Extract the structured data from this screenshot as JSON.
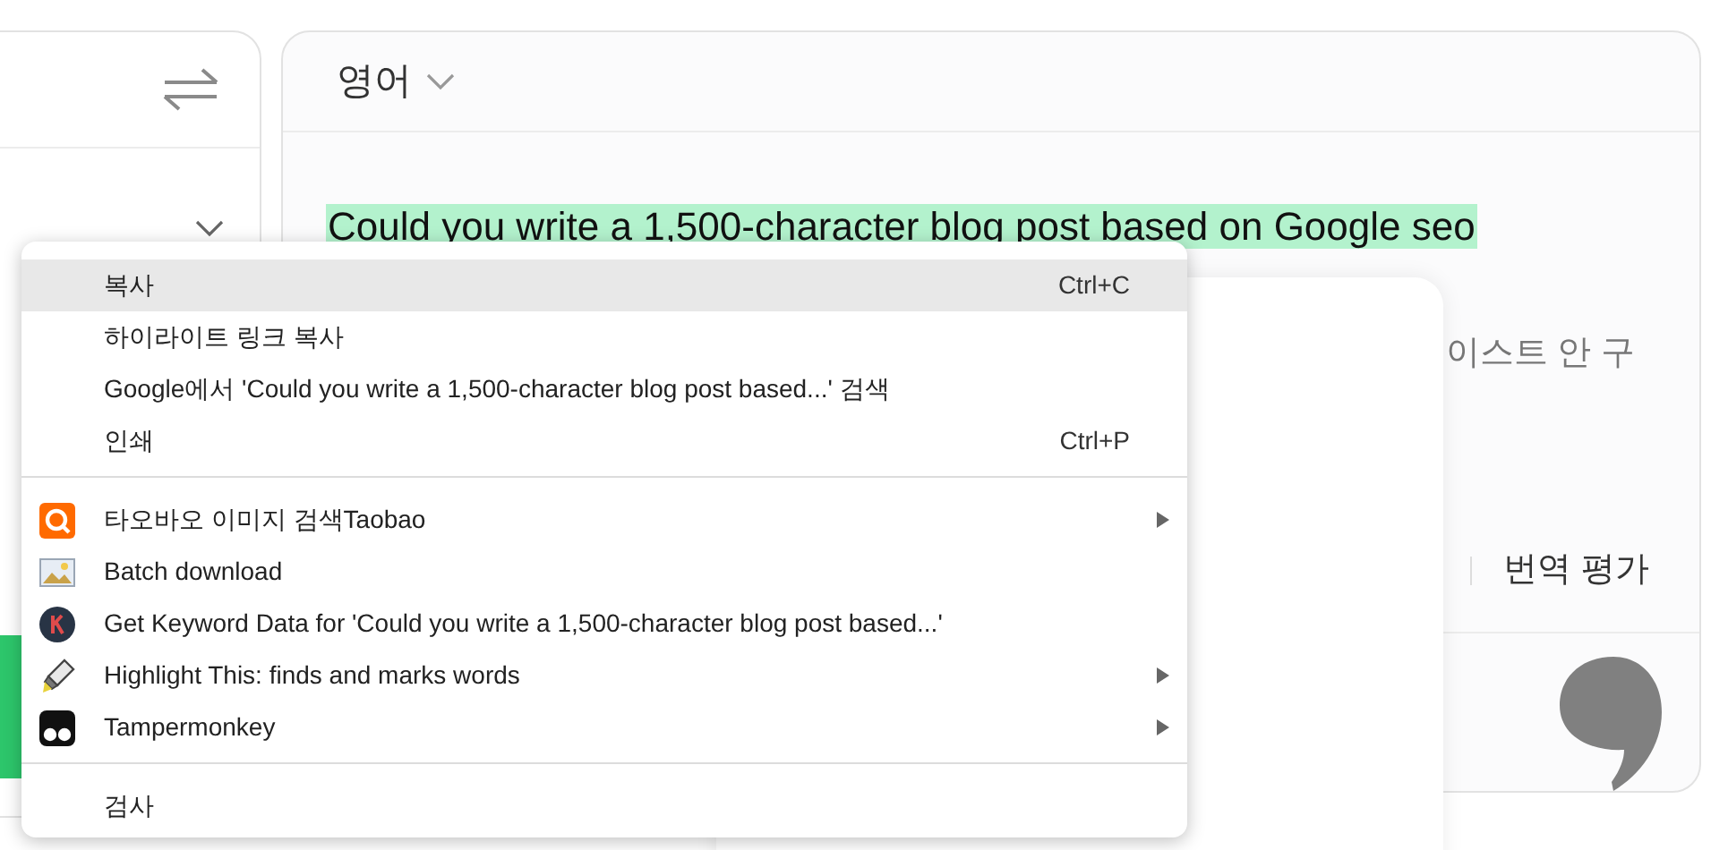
{
  "right_panel": {
    "language": "영어",
    "highlighted_text": "Could you write a 1,500-character blog post based on Google seo",
    "partial_text": "이스트 안 구",
    "rate_button": "번역 평가"
  },
  "context_menu": {
    "groups": [
      [
        {
          "label": "복사",
          "shortcut": "Ctrl+C",
          "selected": true,
          "submenu": false
        },
        {
          "label": "하이라이트 링크 복사",
          "selected": false,
          "submenu": false
        },
        {
          "label": "Google에서 'Could you write a 1,500-character blog post based...' 검색",
          "selected": false,
          "submenu": false
        },
        {
          "label": "인쇄",
          "shortcut": "Ctrl+P",
          "selected": false,
          "submenu": false
        }
      ],
      [
        {
          "label": "타오바오 이미지 검색Taobao",
          "selected": false,
          "submenu": true
        },
        {
          "label": "Batch download",
          "selected": false,
          "submenu": false
        },
        {
          "label": "Get Keyword Data for 'Could you write a 1,500-character blog post based...'",
          "selected": false,
          "submenu": false
        },
        {
          "label": "Highlight This: finds and marks words",
          "selected": false,
          "submenu": true
        },
        {
          "label": "Tampermonkey",
          "selected": false,
          "submenu": true
        }
      ],
      [
        {
          "label": "검사",
          "selected": false,
          "submenu": false
        }
      ]
    ]
  }
}
